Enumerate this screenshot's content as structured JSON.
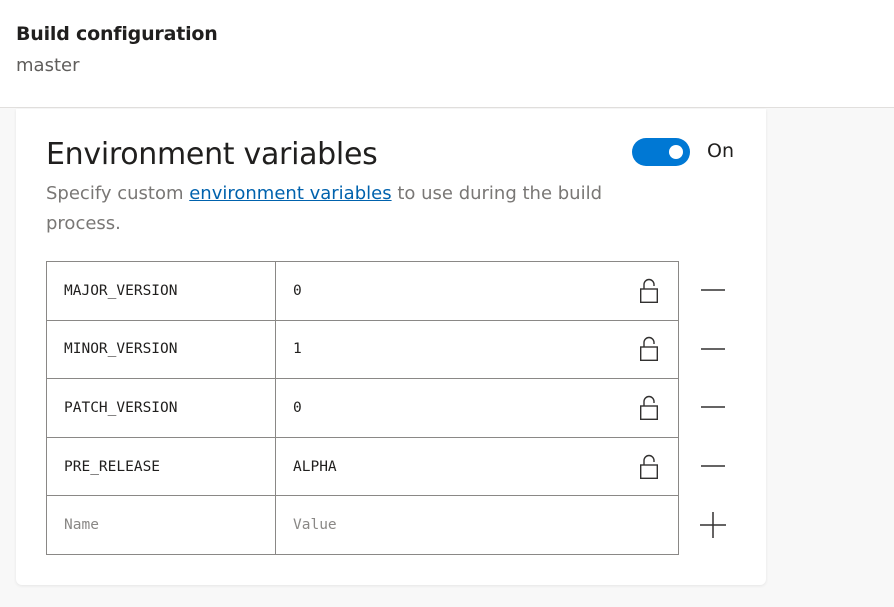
{
  "header": {
    "title": "Build configuration",
    "branch": "master"
  },
  "section": {
    "title": "Environment variables",
    "toggle_label": "On",
    "toggle_on": true,
    "description_before": "Specify custom ",
    "description_link": "environment variables",
    "description_after": " to use during the build process."
  },
  "variables": [
    {
      "name": "MAJOR_VERSION",
      "value": "0",
      "icon": "unlocked-padlock-icon"
    },
    {
      "name": "MINOR_VERSION",
      "value": "1",
      "icon": "unlocked-padlock-icon"
    },
    {
      "name": "PATCH_VERSION",
      "value": "0",
      "icon": "unlocked-padlock-icon"
    },
    {
      "name": "PRE_RELEASE",
      "value": "ALPHA",
      "icon": "unlocked-padlock-icon"
    }
  ],
  "new_variable": {
    "name_placeholder": "Name",
    "value_placeholder": "Value"
  },
  "colors": {
    "accent": "#0078d4",
    "link": "#0062ad"
  }
}
